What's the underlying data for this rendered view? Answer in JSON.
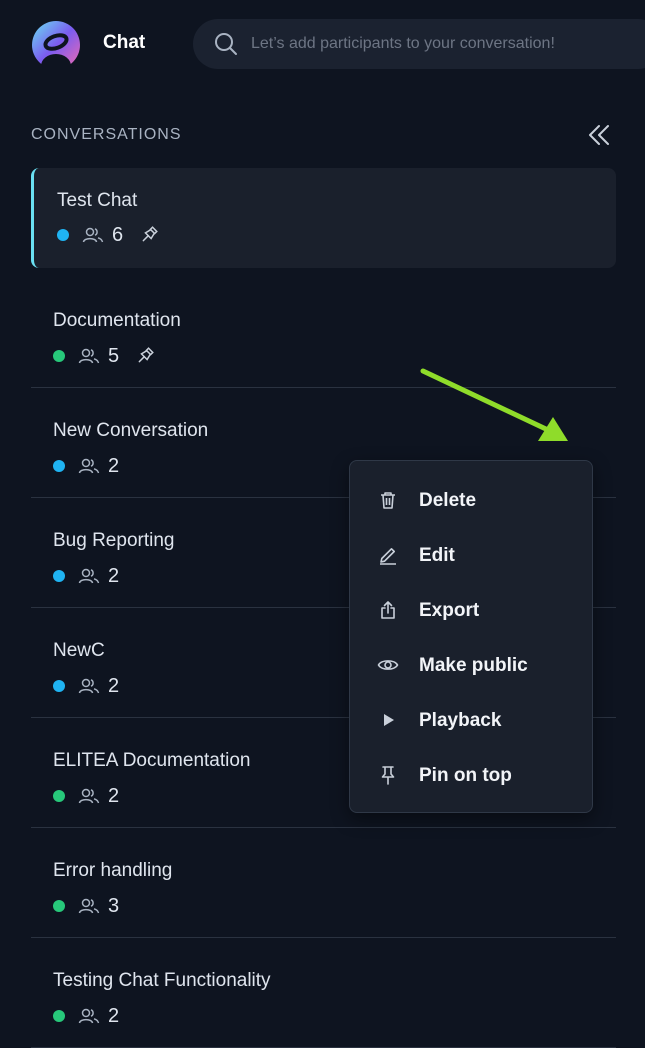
{
  "header": {
    "app_title": "Chat",
    "search_placeholder": "Let’s add participants to your conversation!"
  },
  "sidebar": {
    "section_title": "CONVERSATIONS",
    "items": [
      {
        "name": "Test Chat",
        "status_color": "#1fb3f2",
        "participants": "6",
        "pinned": true,
        "active": true
      },
      {
        "name": "Documentation",
        "status_color": "#27c87a",
        "participants": "5",
        "pinned": true
      },
      {
        "name": "New Conversation",
        "status_color": "#1fb3f2",
        "participants": "2"
      },
      {
        "name": "Bug Reporting",
        "status_color": "#1fb3f2",
        "participants": "2"
      },
      {
        "name": "NewC",
        "status_color": "#1fb3f2",
        "participants": "2"
      },
      {
        "name": "ELITEA Documentation",
        "status_color": "#27c87a",
        "participants": "2"
      },
      {
        "name": "Error handling",
        "status_color": "#27c87a",
        "participants": "3"
      },
      {
        "name": "Testing Chat Functionality",
        "status_color": "#27c87a",
        "participants": "2"
      }
    ]
  },
  "context_menu": {
    "items": [
      {
        "label": "Delete",
        "icon": "trash-icon"
      },
      {
        "label": "Edit",
        "icon": "pencil-icon"
      },
      {
        "label": "Export",
        "icon": "export-icon"
      },
      {
        "label": "Make public",
        "icon": "eye-icon"
      },
      {
        "label": "Playback",
        "icon": "play-icon"
      },
      {
        "label": "Pin on top",
        "icon": "pin-icon"
      }
    ]
  },
  "annotation": {
    "arrow_color": "#8fdc2a"
  }
}
